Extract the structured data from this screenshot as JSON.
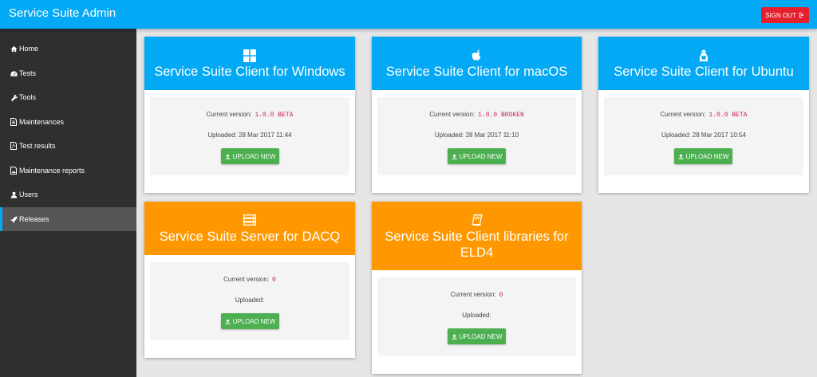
{
  "app": {
    "title": "Service Suite Admin",
    "sign_out_label": "SIGN OUT",
    "colors": {
      "primary": "#03a9f4",
      "server": "#ff9800",
      "danger": "#e5202e",
      "success": "#4caf50",
      "sidebar": "#2f2f2f"
    }
  },
  "sidebar": {
    "items": [
      {
        "label": "Home",
        "icon": "home-icon"
      },
      {
        "label": "Tests",
        "icon": "dashboard-icon"
      },
      {
        "label": "Tools",
        "icon": "wrench-icon"
      },
      {
        "label": "Maintenances",
        "icon": "document-icon"
      },
      {
        "label": "Test results",
        "icon": "pdf-document-icon"
      },
      {
        "label": "Maintenance reports",
        "icon": "image-document-icon"
      },
      {
        "label": "Users",
        "icon": "user-icon"
      },
      {
        "label": "Releases",
        "icon": "rocket-icon",
        "active": true
      }
    ]
  },
  "releases": [
    {
      "title": "Service Suite Client for Windows",
      "icon": "windows-icon",
      "version_label": "Current version:",
      "version": "1.0.0 BETA",
      "uploaded_label": "Uploaded:",
      "uploaded": "28 Mar 2017 11:44",
      "button": "UPLOAD NEW"
    },
    {
      "title": "Service Suite Client for macOS",
      "icon": "apple-icon",
      "version_label": "Current version:",
      "version": "1.0.0 BROKEN",
      "uploaded_label": "Uploaded:",
      "uploaded": "28 Mar 2017 11:10",
      "button": "UPLOAD NEW"
    },
    {
      "title": "Service Suite Client for Ubuntu",
      "icon": "linux-icon",
      "version_label": "Current version:",
      "version": "1.0.0 BETA",
      "uploaded_label": "Uploaded:",
      "uploaded": "28 Mar 2017 10:54",
      "button": "UPLOAD NEW"
    },
    {
      "title": "Service Suite Server for DACQ",
      "icon": "server-icon",
      "version_label": "Current version:",
      "version": "0",
      "uploaded_label": "Uploaded:",
      "uploaded": "",
      "button": "UPLOAD NEW"
    },
    {
      "title": "Service Suite Client libraries for ELD4",
      "icon": "book-icon",
      "version_label": "Current version:",
      "version": "0",
      "uploaded_label": "Uploaded:",
      "uploaded": "",
      "button": "UPLOAD NEW"
    }
  ]
}
